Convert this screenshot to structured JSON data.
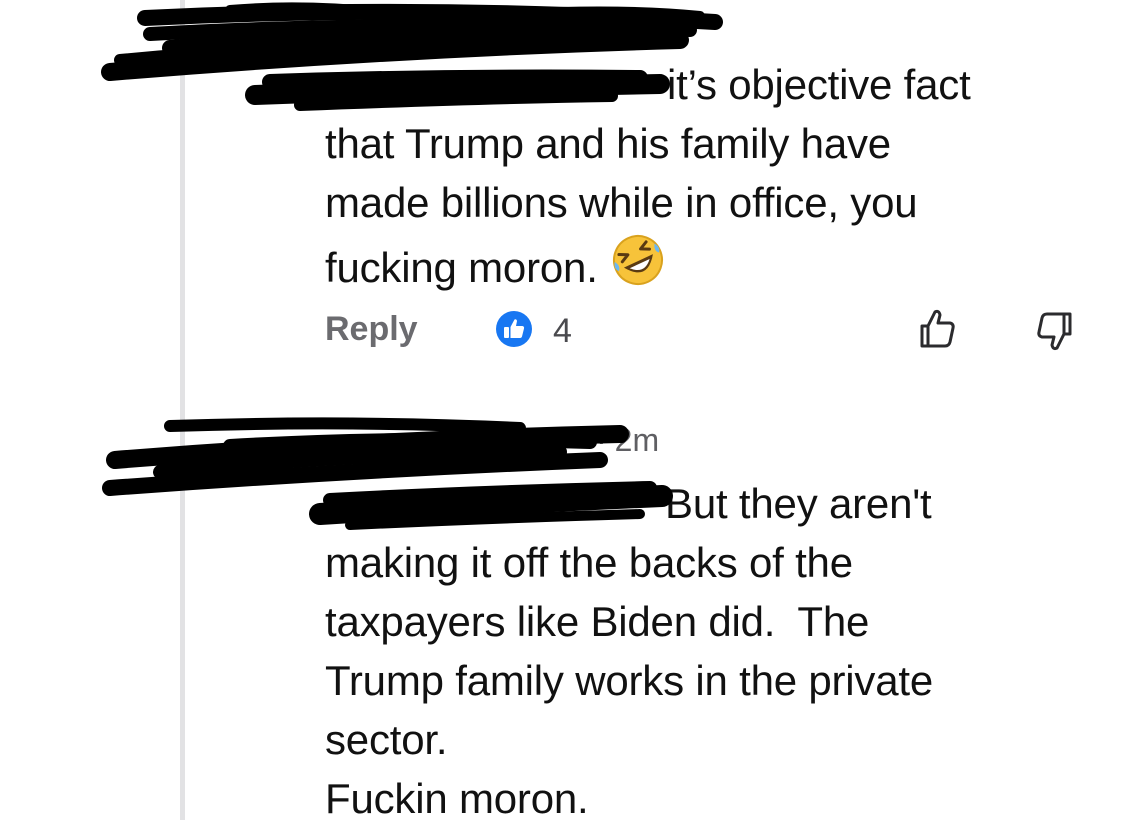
{
  "comments": [
    {
      "lines": [
        "it’s objective fact",
        "that Trump and his family have",
        "made billions while in office, you",
        "fucking moron."
      ],
      "emoji": "rolling-on-floor-laughing-emoji",
      "actions": {
        "reply_label": "Reply",
        "like_count": "4"
      }
    },
    {
      "time": "2m",
      "lines": [
        "But they aren't",
        "making it off the backs of the",
        "taxpayers like Biden did.  The",
        "Trump family works in the private",
        "sector.",
        "Fuckin moron."
      ]
    }
  ],
  "icons": {
    "like_badge": "thumbs-up-badge-icon",
    "thumb_up": "thumbs-up-outline-icon",
    "thumb_down": "thumbs-down-outline-icon"
  },
  "colors": {
    "like_badge": "#1877f2",
    "emoji_face": "#f7c33a",
    "redaction": "#000000",
    "thread_line": "#e2e2e4"
  }
}
